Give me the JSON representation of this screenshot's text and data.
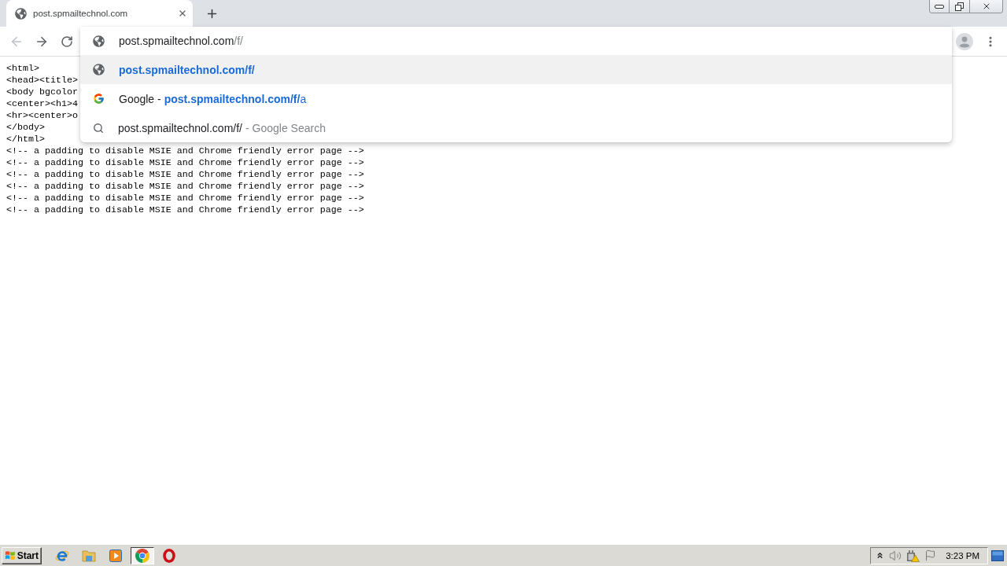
{
  "tabs": [
    {
      "title": "post.spmailtechnol.com",
      "selected": true
    }
  ],
  "toolbar": {
    "back": {
      "disabled": true
    },
    "forward": {
      "disabled": false
    }
  },
  "omnibox": {
    "text": "post.spmailtechnol.com",
    "completion": "/f/",
    "suggestions": [
      {
        "kind": "url",
        "selected": true,
        "url": "post.spmailtechnol.com/f/"
      },
      {
        "kind": "google",
        "selected": false,
        "title": "Google -",
        "url": "**post.spmailtechnol.com/f/**a"
      },
      {
        "kind": "search",
        "selected": false,
        "query": "post.spmailtechnol.com/f/",
        "suffix": "- Google Search"
      }
    ]
  },
  "page": {
    "source_lines": [
      "<html>",
      "<head><title>",
      "<body bgcolor",
      "<center><h1>4",
      "<hr><center>o",
      "</body>",
      "</html>",
      "<!-- a padding to disable MSIE and Chrome friendly error page -->",
      "<!-- a padding to disable MSIE and Chrome friendly error page -->",
      "<!-- a padding to disable MSIE and Chrome friendly error page -->",
      "<!-- a padding to disable MSIE and Chrome friendly error page -->",
      "<!-- a padding to disable MSIE and Chrome friendly error page -->",
      "<!-- a padding to disable MSIE and Chrome friendly error page -->"
    ]
  },
  "taskbar": {
    "start": "Start",
    "apps": [
      {
        "kind": "web",
        "selected": false
      },
      {
        "kind": "folder",
        "selected": false
      },
      {
        "kind": "media",
        "selected": false
      },
      {
        "kind": "wheel",
        "selected": true
      },
      {
        "kind": "ring",
        "selected": false
      }
    ],
    "clock": "3:23 PM"
  }
}
